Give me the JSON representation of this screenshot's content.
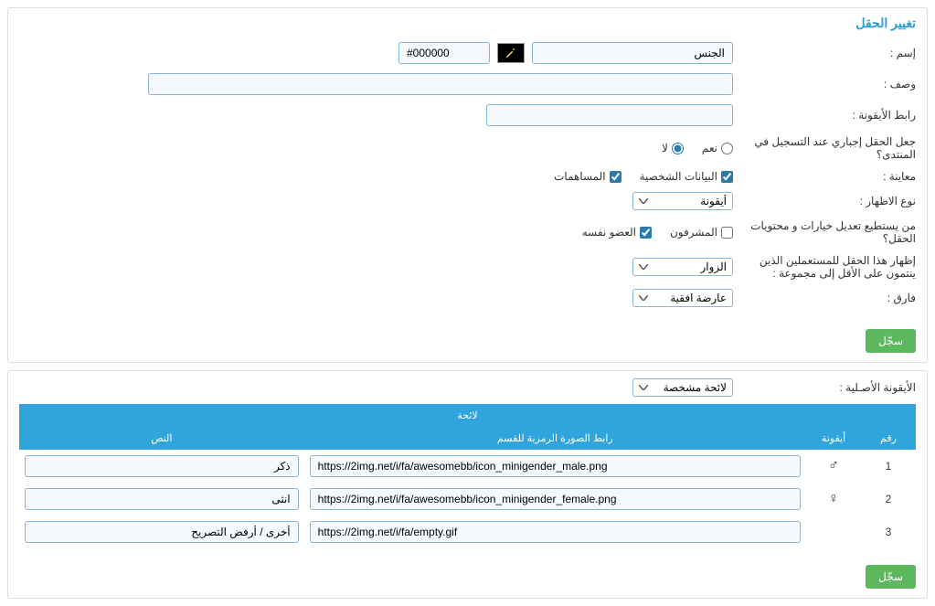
{
  "panel1": {
    "title": "تغيير الحقل",
    "labels": {
      "name": "إسم :",
      "desc": "وصف :",
      "icon_link": "رابط الأيقونة :",
      "required": "جعل الحقل إجباري عند التسجيل في المنتدى؟",
      "preview": "معاينة :",
      "display_type": "نوع الاظهار :",
      "who_modify": "من يستطيع تعديل خيارات و محتويات الحقل؟",
      "show_for_group": "إظهار هذا الحقل للمستعملين الذين ينتمون على الأقل إلى مجموعة :",
      "separator": "فارق :"
    },
    "name_value": "الجنس",
    "color_code": "#000000",
    "yes": "نعم",
    "no": "لا",
    "personal_data": "البيانات الشخصية",
    "contributions": "المساهمات",
    "display_type_value": "أيقونة",
    "moderators": "المشرفون",
    "member_self": "العضو نفسه",
    "visitors": "الزوار",
    "separator_value": "عارضة افقية",
    "save": "سجّل"
  },
  "panel2": {
    "original_icon": "الأيقونة الأصـلية :",
    "custom_list": "لائحة مشخصة",
    "table": {
      "header_top": "لائحة",
      "col_num": "رقم",
      "col_icon": "أيقونة",
      "col_url": "رابط الصورة الرمزية للقسم",
      "col_text": "النص",
      "rows": [
        {
          "num": "1",
          "icon": "♂",
          "url": "https://2img.net/i/fa/awesomebb/icon_minigender_male.png",
          "text": "ذكر"
        },
        {
          "num": "2",
          "icon": "♀",
          "url": "https://2img.net/i/fa/awesomebb/icon_minigender_female.png",
          "text": "انثى"
        },
        {
          "num": "3",
          "icon": "",
          "url": "https://2img.net/i/fa/empty.gif",
          "text": "أخرى / أرفض التصريح"
        }
      ]
    },
    "save": "سجّل"
  }
}
